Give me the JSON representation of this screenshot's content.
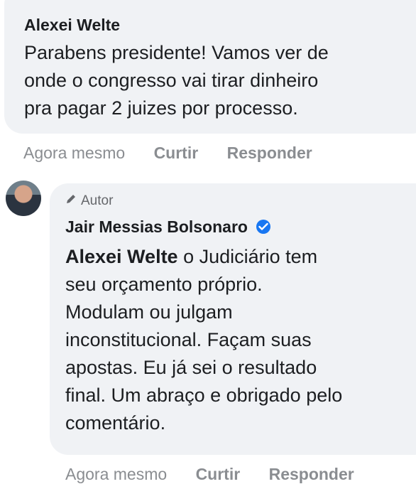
{
  "comment1": {
    "author": "Alexei Welte",
    "lines": [
      "Parabens presidente! Vamos ver de",
      "onde o congresso vai tirar dinheiro",
      "pra pagar 2 juizes por processo."
    ],
    "time": "Agora mesmo",
    "like": "Curtir",
    "reply": "Responder"
  },
  "comment2": {
    "badge": "Autor",
    "author": "Jair Messias Bolsonaro",
    "mention": "Alexei Welte",
    "first_line_rest": " o Judiciário tem",
    "lines": [
      "seu orçamento próprio.",
      "Modulam ou julgam",
      "inconstitucional. Façam suas",
      "apostas. Eu já sei o resultado",
      "final. Um abraço e obrigado pelo",
      "comentário."
    ],
    "time": "Agora mesmo",
    "like": "Curtir",
    "reply": "Responder"
  },
  "icons": {
    "pencil": "pencil-icon",
    "verified": "verified-badge-icon"
  },
  "colors": {
    "bubble": "#f0f2f5",
    "meta": "#8a8d91",
    "verified": "#1877f2"
  }
}
